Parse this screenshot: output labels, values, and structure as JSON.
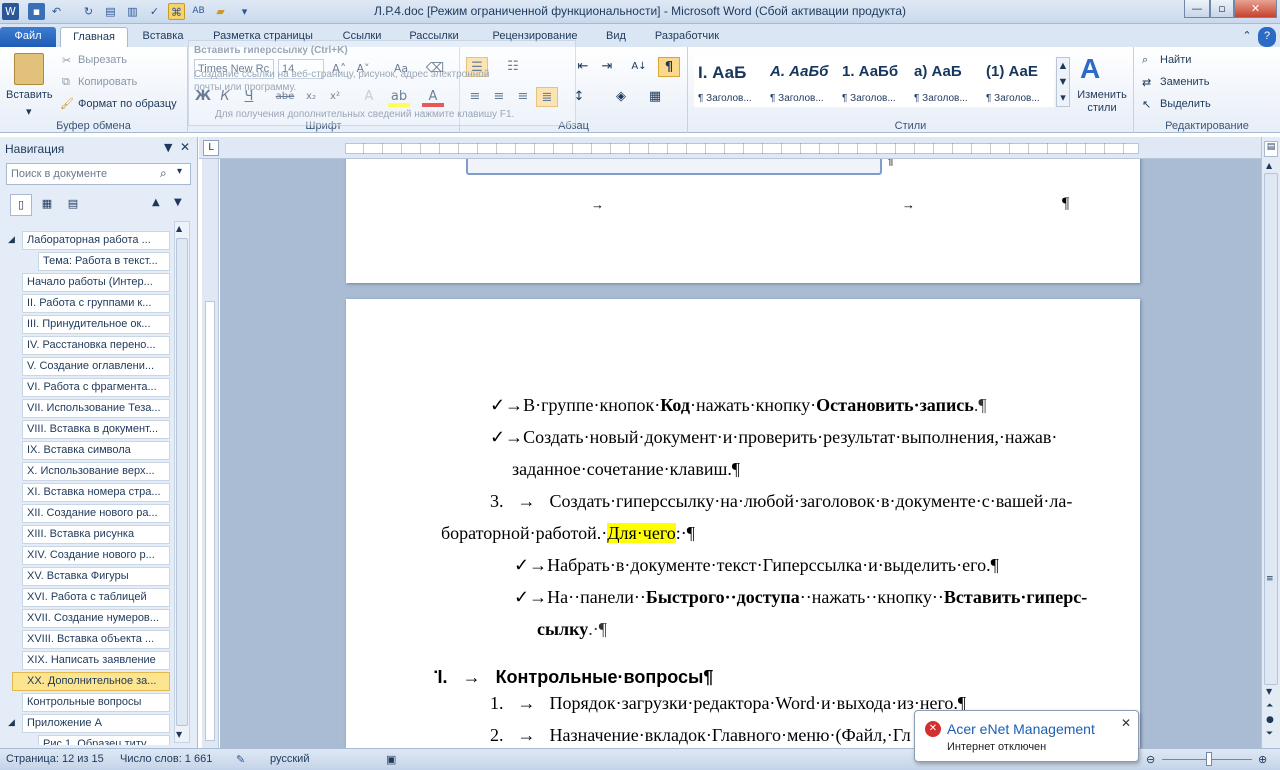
{
  "window": {
    "title": "Л.Р.4.doc [Режим ограниченной функциональности] - Microsoft Word (Сбой активации продукта)"
  },
  "tabs": [
    "Файл",
    "Главная",
    "Вставка",
    "Разметка страницы",
    "Ссылки",
    "Рассылки",
    "Рецензирование",
    "Вид",
    "Разработчик"
  ],
  "ribbon": {
    "clipboard": {
      "paste": "Вставить",
      "cut": "Вырезать",
      "copy": "Копировать",
      "format_painter": "Формат по образцу",
      "label": "Буфер обмена"
    },
    "font": {
      "name": "Times New Rc",
      "size": "14",
      "label": "Шрифт"
    },
    "paragraph": {
      "label": "Абзац"
    },
    "styles": {
      "label": "Стили",
      "items": [
        {
          "sample": "I. АаБ",
          "name": "¶ Заголов..."
        },
        {
          "sample": "А. АаБб",
          "name": "¶ Заголов..."
        },
        {
          "sample": "1. АаБб",
          "name": "¶ Заголов..."
        },
        {
          "sample": "а) АаБ",
          "name": "¶ Заголов..."
        },
        {
          "sample": "(1) АаЕ",
          "name": "¶ Заголов..."
        }
      ],
      "change": "Изменить стили"
    },
    "editing": {
      "find": "Найти",
      "replace": "Заменить",
      "select": "Выделить",
      "label": "Редактирование"
    }
  },
  "tooltip": {
    "title": "Вставить гиперссылку (Ctrl+K)",
    "line1": "Создание ссылки на веб-страницу, рисунок, адрес электронной",
    "line2": "почты или программу.",
    "help": "Для получения дополнительных сведений нажмите клавишу F1."
  },
  "nav": {
    "title": "Навигация",
    "search_placeholder": "Поиск в документе",
    "items": [
      "Лабораторная работа ...",
      "Тема: Работа в текст...",
      "Начало работы (Интер...",
      "II. Работа с группами к...",
      "III. Принудительное ок...",
      "IV. Расстановка перено...",
      "V. Создание оглавлени...",
      "VI. Работа с фрагмента...",
      "VII. Использование Теза...",
      "VIII. Вставка в документ...",
      "IX. Вставка символа",
      "X. Использование верх...",
      "XI. Вставка номера стра...",
      "XII. Создание нового ра...",
      "XIII. Вставка рисунка",
      "XIV. Создание нового р...",
      "XV. Вставка Фигуры",
      "XVI. Работа с таблицей",
      "XVII. Создание нумеров...",
      "XVIII. Вставка объекта ...",
      "XIX. Написать заявление",
      "XX. Дополнительное за...",
      "Контрольные вопросы",
      "Приложение А",
      "Рис.1. Образец титу..."
    ]
  },
  "document": {
    "l1a": "В·группе·кнопок·",
    "l1b": "Код",
    "l1c": "·нажать·кнопку·",
    "l1d": "Остановить·запись",
    "l2": "Создать·новый·документ·и·проверить·результат·выполнения,·нажав·",
    "l3": "заданное·сочетание·клавиш.¶",
    "l4num": "3.",
    "l4": "Создать·гиперссылку·на·любой·заголовок·в·документе·с·вашей·ла-",
    "l5a": "бораторной·работой.·",
    "l5b": "Для·чего",
    "l5c": ":·¶",
    "l6": "Набрать·в·документе·текст·Гиперссылка·и·выделить·его.¶",
    "l7a": "На··панели··",
    "l7b": "Быстрого··доступа",
    "l7c": "··нажать··кнопку··",
    "l7d": "Вставить·гиперс-",
    "l8": "сылку",
    "h_num": "I.",
    "h_text": "Контрольные·вопросы¶",
    "q1num": "1.",
    "q1": "Порядок·загрузки·редактора·Word·и·выхода·из·него.¶",
    "q2num": "2.",
    "q2": "Назначение·вкладок·Главного·меню·(Файл,·Гл"
  },
  "status": {
    "page": "Страница: 12 из 15",
    "words": "Число слов: 1 661",
    "lang": "русский"
  },
  "notification": {
    "title": "Acer eNet Management",
    "text": "Интернет отключен"
  }
}
